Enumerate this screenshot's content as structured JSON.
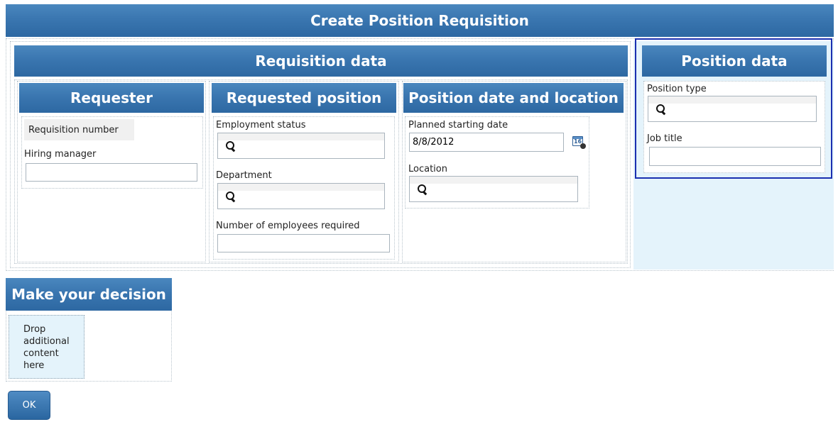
{
  "page": {
    "title": "Create Position Requisition"
  },
  "requisition": {
    "title": "Requisition data",
    "requester": {
      "title": "Requester",
      "requisition_number_label": "Requisition number",
      "hiring_manager_label": "Hiring manager",
      "hiring_manager_value": ""
    },
    "requested_position": {
      "title": "Requested position",
      "employment_status_label": "Employment status",
      "department_label": "Department",
      "num_employees_label": "Number of employees required",
      "num_employees_value": ""
    },
    "date_location": {
      "title": "Position date and location",
      "start_date_label": "Planned starting date",
      "start_date_value": "8/8/2012",
      "calendar_icon_text": "16",
      "location_label": "Location"
    }
  },
  "position": {
    "title": "Position data",
    "position_type_label": "Position type",
    "job_title_label": "Job title",
    "job_title_value": ""
  },
  "decision": {
    "title": "Make your decision",
    "drop_text": "Drop additional content here"
  },
  "actions": {
    "ok_label": "OK"
  },
  "icons": [
    "search-icon",
    "calendar-icon"
  ],
  "colors": {
    "header_blue": "#3a76b0",
    "selection_border": "#1a2fb0",
    "panel_light_blue": "#e4f3fb"
  }
}
